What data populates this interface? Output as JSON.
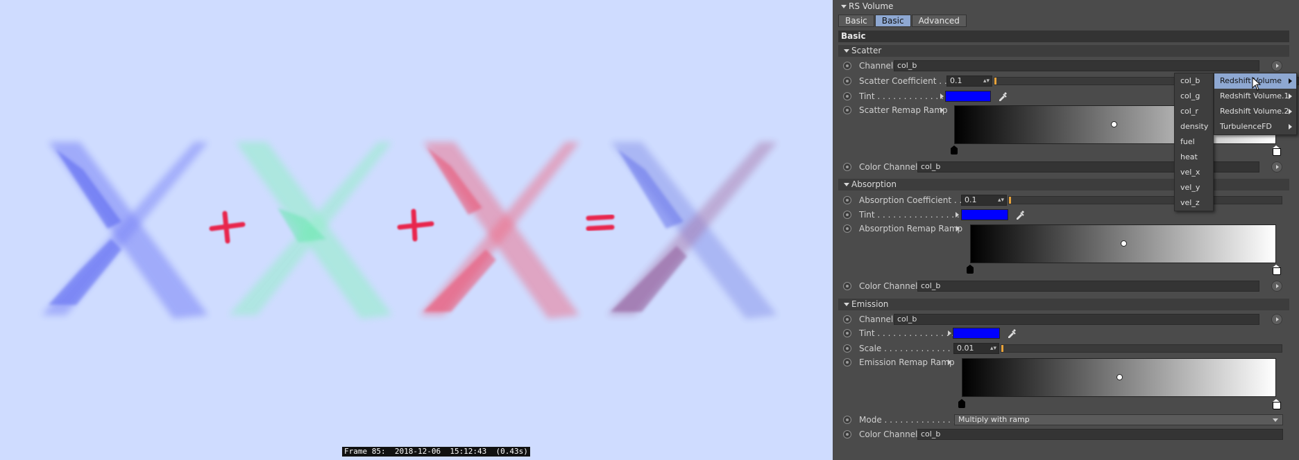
{
  "viewport": {
    "status_text": "Frame 85:  2018-12-06  15:12:43  (0.43s)",
    "operators": [
      "+",
      "+",
      "="
    ],
    "colors": {
      "background": "#cfdcff",
      "blue": "#6a73f5",
      "green": "#8ff0c4",
      "red": "#f2627a",
      "mix_blue": "#7f8ae6",
      "mix_purple": "#a2689c",
      "operator": "#e8284d"
    }
  },
  "panel": {
    "title": "RS Volume",
    "tabs": [
      {
        "label": "Basic",
        "active": false
      },
      {
        "label": "Basic",
        "active": true
      },
      {
        "label": "Advanced",
        "active": false
      }
    ],
    "section_label": "Basic",
    "scatter": {
      "header": "Scatter",
      "channel_label": "Channel",
      "channel_value": "col_b",
      "coefficient_label": "Scatter Coefficient . . .",
      "coefficient_value": "0.1",
      "coefficient_fraction": 0.1,
      "tint_label": "Tint . . . . . . . . . . . . . . . .",
      "tint_color": "#0000ff",
      "ramp_label": "Scatter Remap Ramp",
      "color_channel_label": "Color Channel",
      "color_channel_value": "col_b"
    },
    "absorption": {
      "header": "Absorption",
      "coefficient_label": "Absorption Coefficient . . .",
      "coefficient_value": "0.1",
      "coefficient_fraction": 0.1,
      "tint_label": "Tint . . . . . . . . . . . . . . . . . .",
      "tint_color": "#0000ff",
      "ramp_label": "Absorption Remap Ramp",
      "color_channel_label": "Color Channel",
      "color_channel_value": "col_b"
    },
    "emission": {
      "header": "Emission",
      "channel_label": "Channel",
      "channel_value": "col_b",
      "tint_label": "Tint . . . . . . . . . . . . . . . . . .",
      "tint_color": "#0000ff",
      "scale_label": "Scale . . . . . . . . . . . . . . .",
      "scale_value": "0.01",
      "scale_fraction": 0.01,
      "ramp_label": "Emission Remap Ramp",
      "mode_label": "Mode . . . . . . . . . . . . . . . .",
      "mode_value": "Multiply with ramp",
      "color_channel_label": "Color Channel",
      "color_channel_value": "col_b"
    }
  },
  "channel_menu": {
    "items": [
      "col_b",
      "col_g",
      "col_r",
      "density",
      "fuel",
      "heat",
      "vel_x",
      "vel_y",
      "vel_z"
    ]
  },
  "object_menu": {
    "items": [
      {
        "label": "Redshift Volume",
        "highlighted": true
      },
      {
        "label": "Redshift Volume.1",
        "highlighted": false
      },
      {
        "label": "Redshift Volume.2",
        "highlighted": false
      },
      {
        "label": "TurbulenceFD",
        "highlighted": false
      }
    ]
  }
}
